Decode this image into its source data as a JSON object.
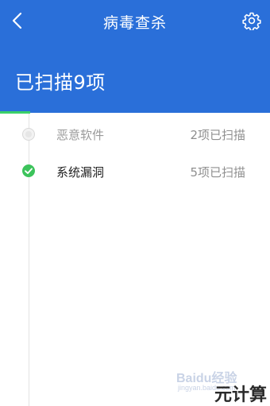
{
  "header": {
    "title": "病毒查杀",
    "back_icon": "chevron-left-icon",
    "settings_icon": "gear-icon",
    "summary": "已扫描9项",
    "background_color": "#2a6fd9",
    "progress_color": "#3ad06a"
  },
  "scan_items": [
    {
      "label": "恶意软件",
      "count": "2项已扫描",
      "status": "pending"
    },
    {
      "label": "系统漏洞",
      "count": "5项已扫描",
      "status": "done"
    }
  ],
  "watermark": {
    "logo": "Baidu经验",
    "url": "jingyan.baidu.com",
    "site": "元计算"
  }
}
